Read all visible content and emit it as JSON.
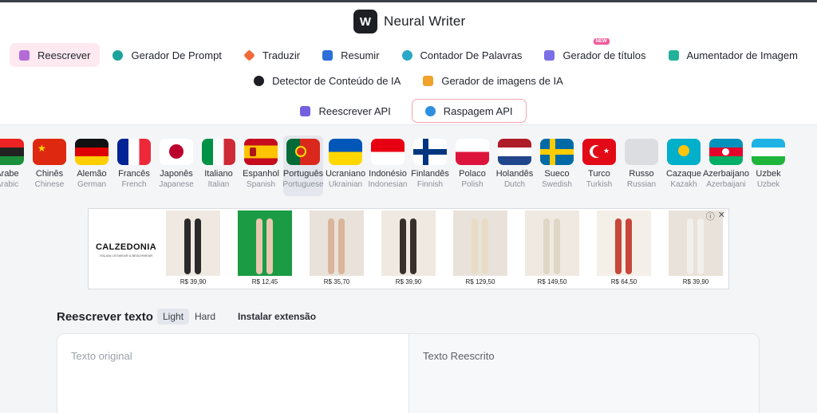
{
  "app": {
    "title": "Neural Writer",
    "logo_mark": "W"
  },
  "nav": {
    "row1": [
      {
        "label": "Reescrever",
        "icon": "rewrite-icon",
        "color": "#b46bd6",
        "active": true
      },
      {
        "label": "Gerador De Prompt",
        "icon": "openai-icon",
        "color": "#1aa39c"
      },
      {
        "label": "Traduzir",
        "icon": "diamond-icon",
        "color": "#f06b3a"
      },
      {
        "label": "Resumir",
        "icon": "cube-icon",
        "color": "#2d6ed8"
      },
      {
        "label": "Contador De Palavras",
        "icon": "globe-icon",
        "color": "#2aa8c9"
      },
      {
        "label": "Gerador de títulos",
        "icon": "wand-icon",
        "color": "#7b6ee6",
        "badge": "NEW"
      },
      {
        "label": "Aumentador de Imagem",
        "icon": "expand-icon",
        "color": "#22b19a"
      }
    ],
    "row2": [
      {
        "label": "Detector de Conteúdo de IA",
        "icon": "detector-icon",
        "color": "#1d1f24"
      },
      {
        "label": "Gerador de imagens de IA",
        "icon": "image-icon",
        "color": "#f0a22a"
      }
    ],
    "row3": [
      {
        "label": "Reescrever API",
        "icon": "api-icon",
        "color": "#7460e0"
      },
      {
        "label": "Raspagem API",
        "icon": "globe-icon",
        "color": "#2d8fe0"
      }
    ]
  },
  "languages": [
    {
      "name": "Árabe",
      "sub": "Arabic"
    },
    {
      "name": "Chinês",
      "sub": "Chinese"
    },
    {
      "name": "Alemão",
      "sub": "German"
    },
    {
      "name": "Francês",
      "sub": "French"
    },
    {
      "name": "Japonês",
      "sub": "Japanese"
    },
    {
      "name": "Italiano",
      "sub": "Italian"
    },
    {
      "name": "Espanhol",
      "sub": "Spanish"
    },
    {
      "name": "Português",
      "sub": "Portuguese",
      "active": true
    },
    {
      "name": "Ucraniano",
      "sub": "Ukrainian"
    },
    {
      "name": "Indonésio",
      "sub": "Indonesian"
    },
    {
      "name": "Finlandês",
      "sub": "Finnish"
    },
    {
      "name": "Polaco",
      "sub": "Polish"
    },
    {
      "name": "Holandês",
      "sub": "Dutch"
    },
    {
      "name": "Sueco",
      "sub": "Swedish"
    },
    {
      "name": "Turco",
      "sub": "Turkish"
    },
    {
      "name": "Russo",
      "sub": "Russian"
    },
    {
      "name": "Cazaque",
      "sub": "Kazakh"
    },
    {
      "name": "Azerbaijano",
      "sub": "Azerbaijani"
    },
    {
      "name": "Uzbek",
      "sub": "Uzbek"
    }
  ],
  "ad": {
    "brand": "CALZEDONIA",
    "brand_sub": "ITALIAN LEGWEAR & BEACHWEAR",
    "close_icons": [
      "info-icon",
      "close-icon"
    ],
    "products": [
      "R$ 39,90",
      "R$ 12,45",
      "R$ 35,70",
      "R$ 39,90",
      "R$ 129,50",
      "R$ 149,50",
      "R$ 64,50",
      "R$ 39,90"
    ]
  },
  "rewrite": {
    "title": "Reescrever texto",
    "modes": [
      "Light",
      "Hard"
    ],
    "active_mode": "Light",
    "extension": "Instalar extensão",
    "original_placeholder": "Texto original",
    "rewritten_placeholder": "Texto Reescrito"
  }
}
